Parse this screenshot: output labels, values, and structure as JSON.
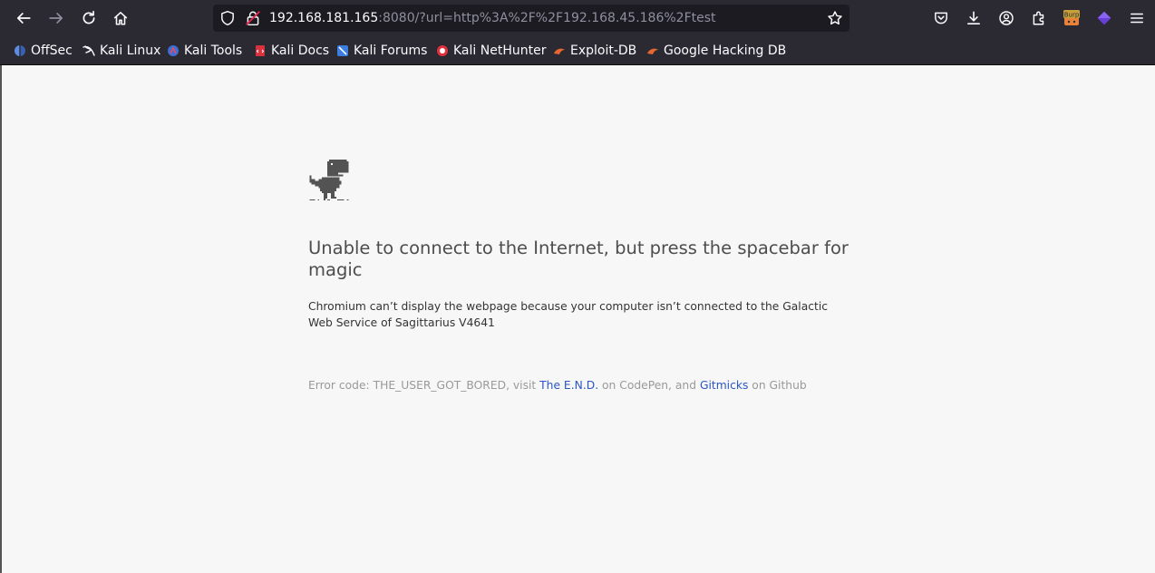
{
  "browser": {
    "url_host": "192.168.181.165",
    "url_rest": ":8080/?url=http%3A%2F%2F192.168.45.186%2Ftest",
    "extension_label": "Burp"
  },
  "bookmarks": [
    {
      "label": "OffSec",
      "icon": "offsec-icon"
    },
    {
      "label": "Kali Linux",
      "icon": "kali-dragon-icon"
    },
    {
      "label": "Kali Tools",
      "icon": "kali-tools-icon"
    },
    {
      "label": "Kali Docs",
      "icon": "kali-docs-icon"
    },
    {
      "label": "Kali Forums",
      "icon": "kali-forums-icon"
    },
    {
      "label": "Kali NetHunter",
      "icon": "nethunter-icon"
    },
    {
      "label": "Exploit-DB",
      "icon": "exploit-db-icon"
    },
    {
      "label": "Google Hacking DB",
      "icon": "ghdb-icon"
    }
  ],
  "page": {
    "headline": "Unable to connect to the Internet, but press the spacebar for magic",
    "description": "Chromium can’t display the webpage because your computer isn’t connected to the Galactic Web Service of Sagittarius V4641",
    "error_prefix": "Error code: THE_USER_GOT_BORED, visit ",
    "link1": "The E.N.D.",
    "error_middle": " on CodePen, and ",
    "link2": "Gitmicks",
    "error_suffix": " on Github"
  }
}
